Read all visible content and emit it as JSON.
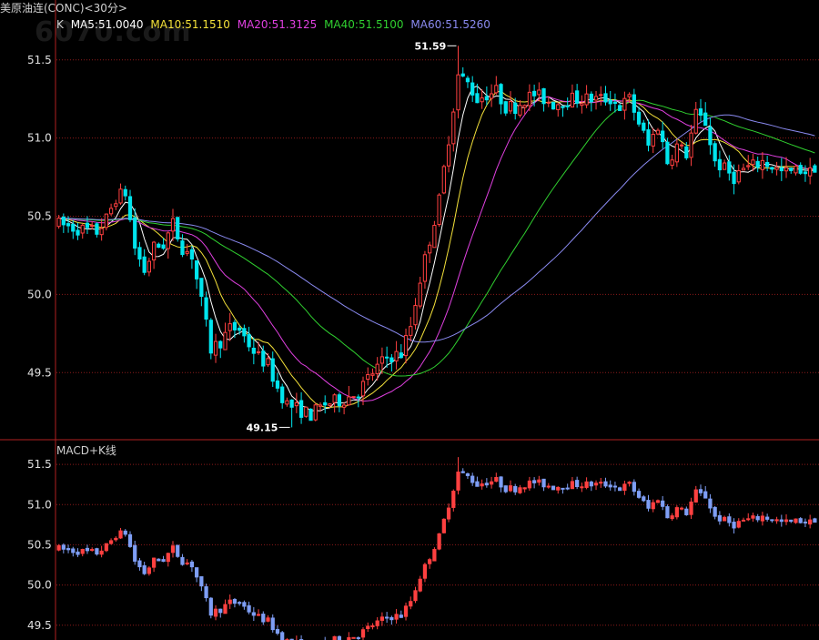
{
  "header": {
    "title": "美原油连(CONC)<30分>",
    "indicator": "K",
    "ma": [
      {
        "label": "MA5:51.0040",
        "color": "#ffffff"
      },
      {
        "label": "MA10:51.1510",
        "color": "#f5e23a"
      },
      {
        "label": "MA20:51.3125",
        "color": "#e040e0"
      },
      {
        "label": "MA40:51.5100",
        "color": "#30d030"
      },
      {
        "label": "MA60:51.5260",
        "color": "#8a8af0"
      }
    ]
  },
  "watermark": "6070.com",
  "sub_panel_label": "MACD+K线",
  "colors": {
    "up": "#ff4040",
    "down": "#00e5ee",
    "sub_down": "#7e9ef5",
    "grid": "#8b1a1a",
    "border": "#b02020"
  },
  "chart_data": [
    {
      "type": "candlestick",
      "panel": "main",
      "ylim": [
        49.1,
        51.65
      ],
      "yticks": [
        "51.5",
        "51.0",
        "50.5",
        "50.0",
        "49.5"
      ],
      "annotations": [
        {
          "text": "51.59",
          "kind": "high"
        },
        {
          "text": "49.15",
          "kind": "low"
        }
      ],
      "anchors": [
        [
          0,
          50.45
        ],
        [
          4,
          50.42
        ],
        [
          8,
          50.4
        ],
        [
          10,
          50.48
        ],
        [
          12,
          50.62
        ],
        [
          14,
          50.65
        ],
        [
          16,
          50.3
        ],
        [
          18,
          50.15
        ],
        [
          20,
          50.3
        ],
        [
          22,
          50.32
        ],
        [
          24,
          50.45
        ],
        [
          26,
          50.3
        ],
        [
          28,
          50.25
        ],
        [
          30,
          49.95
        ],
        [
          32,
          49.65
        ],
        [
          34,
          49.7
        ],
        [
          36,
          49.78
        ],
        [
          38,
          49.78
        ],
        [
          40,
          49.68
        ],
        [
          42,
          49.6
        ],
        [
          44,
          49.55
        ],
        [
          46,
          49.4
        ],
        [
          48,
          49.3
        ],
        [
          50,
          49.27
        ],
        [
          53,
          49.23
        ],
        [
          56,
          49.3
        ],
        [
          60,
          49.33
        ],
        [
          63,
          49.38
        ],
        [
          66,
          49.5
        ],
        [
          69,
          49.6
        ],
        [
          72,
          49.62
        ],
        [
          74,
          49.8
        ],
        [
          76,
          50.1
        ],
        [
          78,
          50.35
        ],
        [
          80,
          50.6
        ],
        [
          82,
          51.0
        ],
        [
          84,
          51.4
        ],
        [
          86,
          51.35
        ],
        [
          88,
          51.25
        ],
        [
          90,
          51.28
        ],
        [
          92,
          51.3
        ],
        [
          94,
          51.2
        ],
        [
          96,
          51.2
        ],
        [
          98,
          51.25
        ],
        [
          100,
          51.28
        ],
        [
          104,
          51.22
        ],
        [
          108,
          51.25
        ],
        [
          112,
          51.25
        ],
        [
          116,
          51.25
        ],
        [
          118,
          51.2
        ],
        [
          120,
          51.25
        ],
        [
          122,
          51.1
        ],
        [
          124,
          50.95
        ],
        [
          126,
          51.08
        ],
        [
          128,
          50.85
        ],
        [
          130,
          50.95
        ],
        [
          132,
          50.9
        ],
        [
          134,
          51.15
        ],
        [
          136,
          51.1
        ],
        [
          138,
          50.85
        ],
        [
          140,
          50.8
        ],
        [
          142,
          50.75
        ],
        [
          144,
          50.8
        ],
        [
          146,
          50.82
        ],
        [
          148,
          50.85
        ],
        [
          150,
          50.82
        ],
        [
          152,
          50.78
        ],
        [
          154,
          50.78
        ],
        [
          156,
          50.8
        ],
        [
          158,
          50.78
        ],
        [
          159,
          50.82
        ]
      ],
      "ma_series": [
        {
          "name": "MA5",
          "color": "#ffffff",
          "period": 5
        },
        {
          "name": "MA10",
          "color": "#f5e23a",
          "period": 10
        },
        {
          "name": "MA20",
          "color": "#e040e0",
          "period": 20
        },
        {
          "name": "MA40",
          "color": "#30d030",
          "period": 40
        },
        {
          "name": "MA60",
          "color": "#8a8af0",
          "period": 60
        }
      ]
    },
    {
      "type": "candlestick",
      "panel": "sub",
      "ylim": [
        49.35,
        51.75
      ],
      "yticks": [
        "51.5",
        "51.0",
        "50.5",
        "50.0",
        "49.5"
      ]
    }
  ]
}
